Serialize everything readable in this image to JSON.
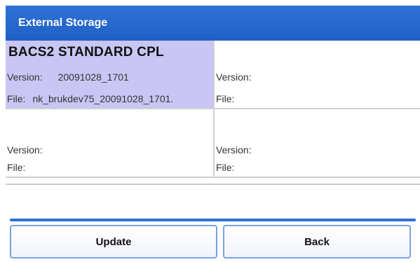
{
  "window": {
    "title": "External Storage"
  },
  "slots": [
    {
      "package": "BACS2 STANDARD CPL",
      "version_label": "Version:",
      "version": "20091028_1701",
      "file_label": "File:",
      "file": "nk_brukdev75_20091028_1701.",
      "selected": true
    },
    {
      "package": "",
      "version_label": "Version:",
      "version": "",
      "file_label": "File:",
      "file": "",
      "selected": false
    },
    {
      "package": "",
      "version_label": "Version:",
      "version": "",
      "file_label": "File:",
      "file": "",
      "selected": false
    },
    {
      "package": "",
      "version_label": "Version:",
      "version": "",
      "file_label": "File:",
      "file": "",
      "selected": false
    }
  ],
  "buttons": {
    "update": "Update",
    "back": "Back"
  },
  "colors": {
    "titlebar": "#2f73d6",
    "selected_slot": "#c9c6f4",
    "rule": "#2e6fd6",
    "button_border": "#7aa3dd"
  }
}
